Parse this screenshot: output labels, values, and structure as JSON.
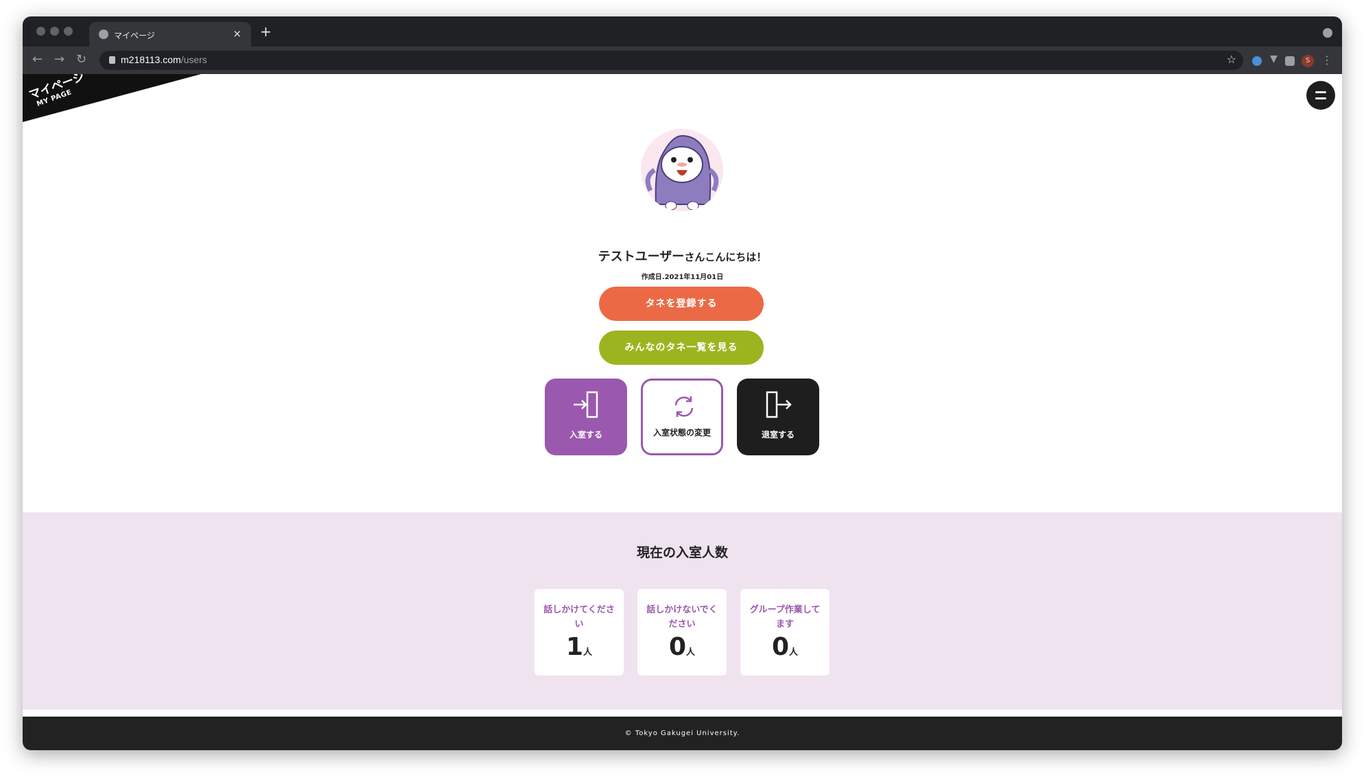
{
  "browser": {
    "tab_title": "マイページ",
    "tab_close": "×",
    "new_tab": "+",
    "url_host": "m218113.com",
    "url_path": "/users",
    "profile_initial": "S",
    "icons": [
      "back-icon",
      "forward-icon",
      "reload-icon",
      "lock-icon",
      "star-icon",
      "extension-icon",
      "kebab-menu-icon"
    ]
  },
  "header": {
    "banner_jp": "マイページ",
    "banner_en": "MY PAGE"
  },
  "user": {
    "name": "テストユーザー",
    "greeting_suffix": "さんこんにちは！",
    "created_at": "作成日.2021年11月01日"
  },
  "actions": {
    "register_seed": "タネを登録する",
    "view_seeds": "みんなのタネ一覧を見る",
    "enter": "入室する",
    "change_status": "入室状態の変更",
    "exit": "退室する"
  },
  "stats": {
    "title": "現在の入室人数",
    "unit": "人",
    "cards": [
      {
        "label": "話しかけてください",
        "count": "1"
      },
      {
        "label": "話しかけないでください",
        "count": "0"
      },
      {
        "label": "グループ作業してます",
        "count": "0"
      }
    ]
  },
  "footer": {
    "copyright": "© Tokyo Gakugei University."
  },
  "colors": {
    "orange": "#eb6a45",
    "green": "#9cb51f",
    "purple": "#9a58ae",
    "dark": "#1e1e1e",
    "stats_bg": "#efe3f0"
  }
}
